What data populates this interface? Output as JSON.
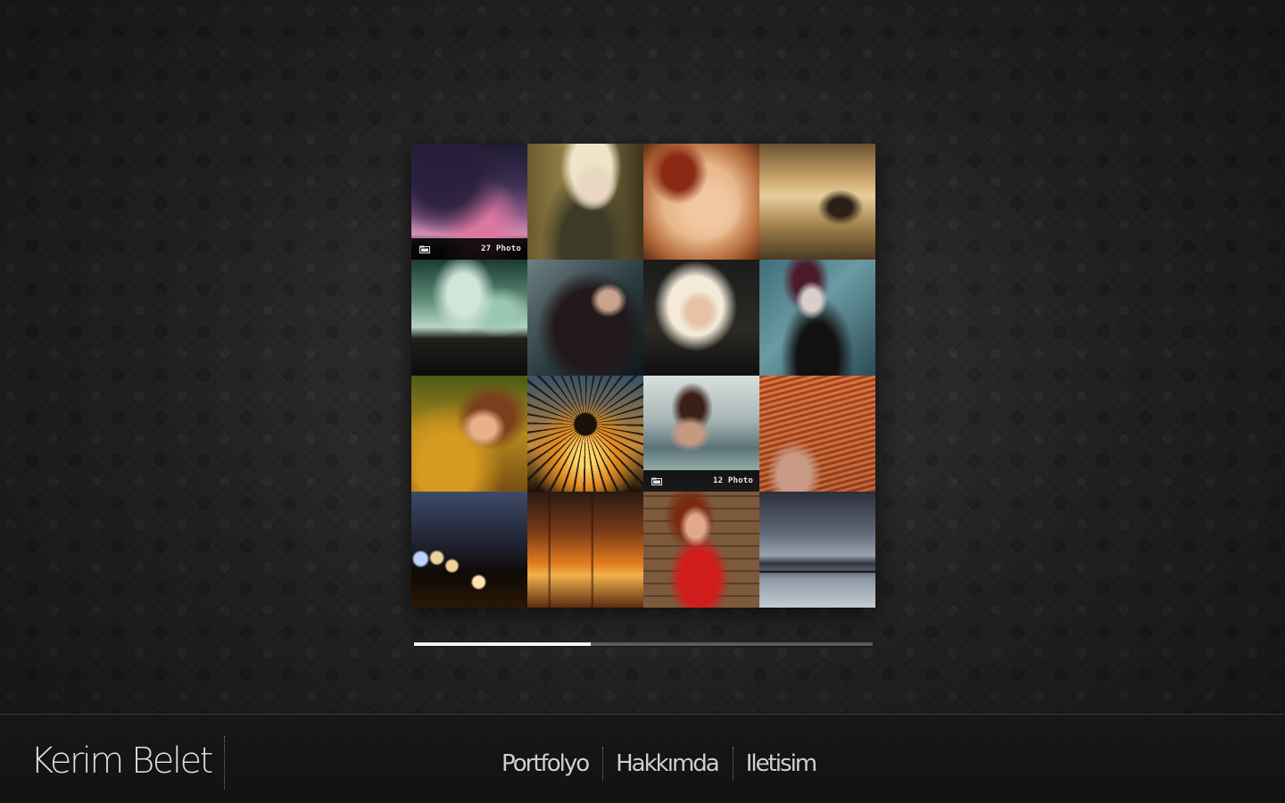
{
  "gallery": {
    "tiles": [
      {
        "subject": "stormy pink sky",
        "count_label": "27 Photo"
      },
      {
        "subject": "blonde woman with beanie"
      },
      {
        "subject": "woman curled on pillows"
      },
      {
        "subject": "figure sitting on beach"
      },
      {
        "subject": "green cloudy sky field"
      },
      {
        "subject": "dark haired woman in profile"
      },
      {
        "subject": "blonde woman portrait"
      },
      {
        "subject": "goth girl with tattoos"
      },
      {
        "subject": "red-haired woman in autumn"
      },
      {
        "subject": "dandelion sunset silhouette"
      },
      {
        "subject": "woman in bikini at sea",
        "count_label": "12 Photo"
      },
      {
        "subject": "red hair blowing in wind"
      },
      {
        "subject": "bokeh lights at dusk"
      },
      {
        "subject": "blurred orange abstract"
      },
      {
        "subject": "woman in red dress by stone wall"
      },
      {
        "subject": "lake with jetty under clouds"
      }
    ]
  },
  "progress": {
    "value": 0.385
  },
  "footer": {
    "brand": "Kerim Belet",
    "nav": [
      {
        "label": "Portfolyo"
      },
      {
        "label": "Hakkımda"
      },
      {
        "label": "Iletisim"
      }
    ]
  },
  "colors": {
    "background": "#242424",
    "footer": "#141414",
    "progress_fill": "#f2f2f2",
    "progress_track": "#5a5a5a",
    "text": "#d0d0d0"
  },
  "icons": {
    "folder": "folder-icon"
  }
}
